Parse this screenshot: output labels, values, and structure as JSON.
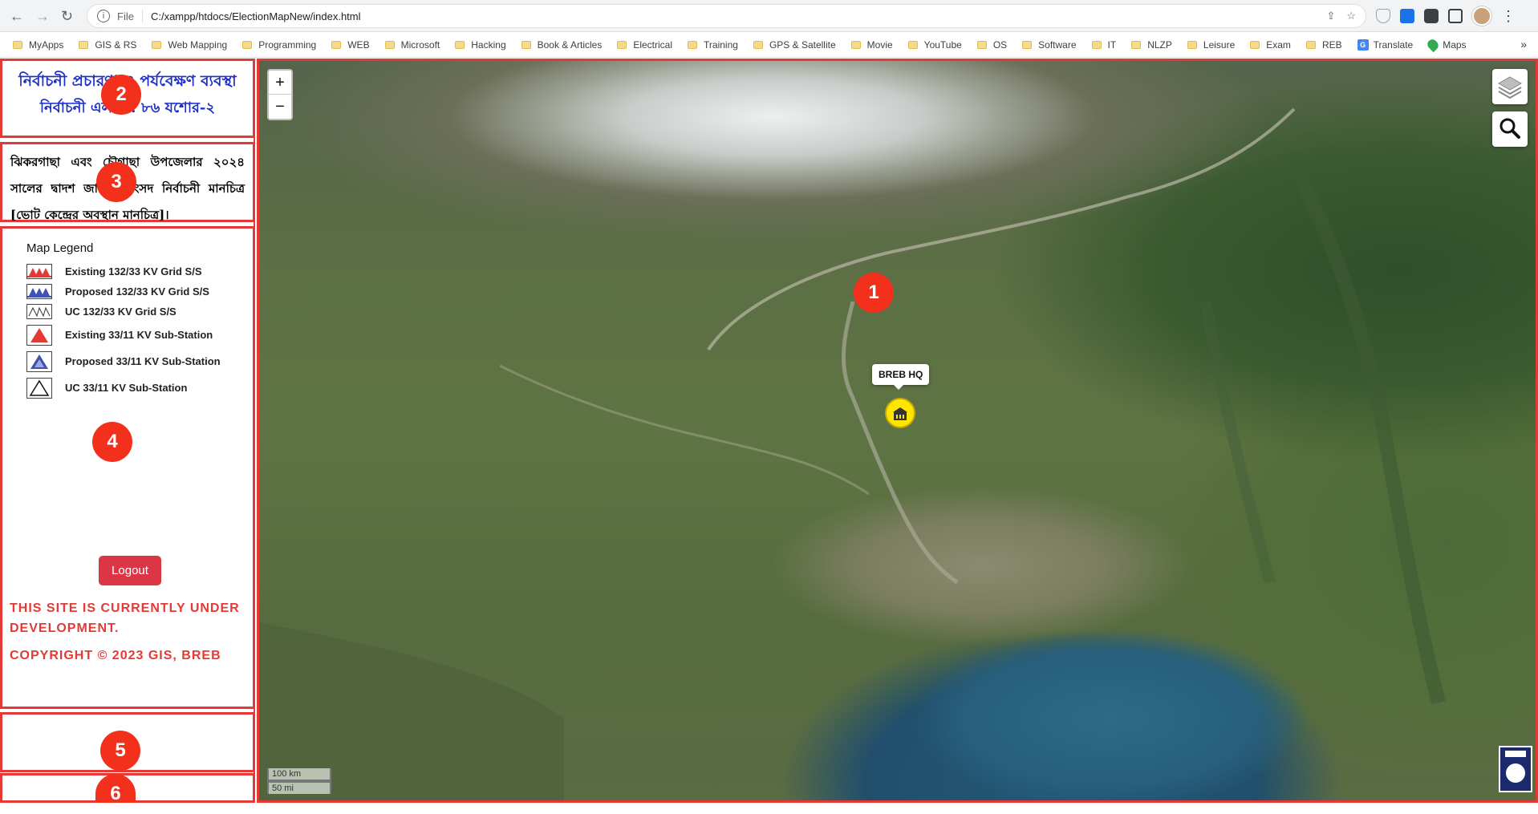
{
  "browser": {
    "nav_back": "←",
    "nav_forward": "→",
    "nav_reload": "↻",
    "info_icon": "i",
    "file_label": "File",
    "url": "C:/xampp/htdocs/ElectionMapNew/index.html",
    "share_icon": "⇪",
    "star_icon": "☆",
    "menu": "⋮",
    "bookmarks": [
      "MyApps",
      "GIS & RS",
      "Web Mapping",
      "Programming",
      "WEB",
      "Microsoft",
      "Hacking",
      "Book & Articles",
      "Electrical",
      "Training",
      "GPS & Satellite",
      "Movie",
      "YouTube",
      "OS",
      "Software",
      "IT",
      "NLZP",
      "Leisure",
      "Exam",
      "REB"
    ],
    "bm_translate": "Translate",
    "bm_maps": "Maps",
    "bm_more": "»"
  },
  "sidebar": {
    "title_line1": "নির্বাচনী প্রচারণা ও পর্যবেক্ষণ ব্যবস্থা",
    "title_line2": "নির্বাচনী এলাকা: ৮৬ যশোর-২",
    "description": "ঝিকরগাছা এবং চৌগাছা উপজেলার ২০২৪ সালের দ্বাদশ জাতীয় সংসদ নির্বাচনী মানচিত্র [ভোট কেন্দ্রের অবস্থান মানচিত্র]।",
    "legend_title": "Map Legend",
    "legend": [
      "Existing 132/33 KV Grid S/S",
      "Proposed 132/33 KV Grid S/S",
      "UC 132/33 KV Grid S/S",
      "Existing 33/11 KV Sub-Station",
      "Proposed 33/11 KV Sub-Station",
      "UC 33/11 KV Sub-Station"
    ],
    "logout_label": "Logout",
    "dev_notice": "THIS SITE IS CURRENTLY UNDER DEVELOPMENT.",
    "copyright": "COPYRIGHT © 2023 GIS, BREB"
  },
  "map": {
    "zoom_in": "+",
    "zoom_out": "−",
    "marker_label": "BREB HQ",
    "scale_km": "100 km",
    "scale_mi": "50 mi"
  },
  "badges": [
    "1",
    "2",
    "3",
    "4",
    "5",
    "6"
  ],
  "colors": {
    "accent_red": "#e53935",
    "title_blue": "#1d2fc8",
    "badge": "#f2301c",
    "logout": "#dc3545"
  }
}
